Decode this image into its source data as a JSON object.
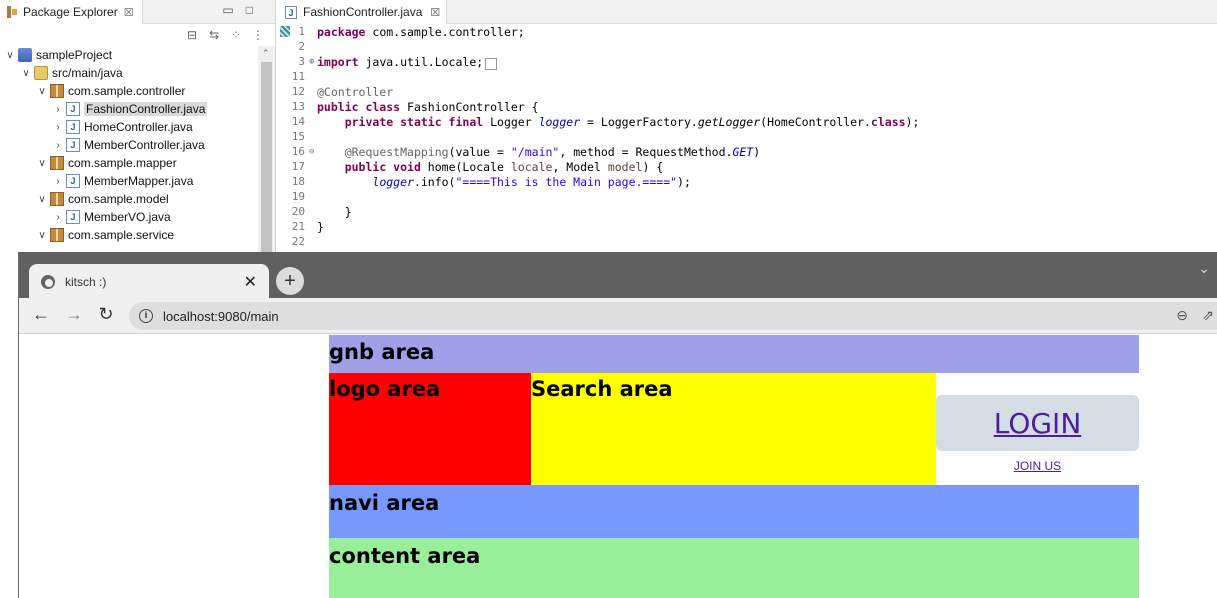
{
  "package_explorer": {
    "tab_label": "Package Explorer",
    "close_glyph": "☒",
    "tree": [
      {
        "indent": 0,
        "arrow": "∨",
        "icon": "project",
        "label": "sampleProject"
      },
      {
        "indent": 1,
        "arrow": "∨",
        "icon": "srcfolder",
        "label": "src/main/java"
      },
      {
        "indent": 2,
        "arrow": "∨",
        "icon": "pkgi",
        "label": "com.sample.controller"
      },
      {
        "indent": 3,
        "arrow": "›",
        "icon": "java",
        "label": "FashionController.java",
        "selected": true
      },
      {
        "indent": 3,
        "arrow": "›",
        "icon": "java",
        "label": "HomeController.java"
      },
      {
        "indent": 3,
        "arrow": "›",
        "icon": "java",
        "label": "MemberController.java"
      },
      {
        "indent": 2,
        "arrow": "∨",
        "icon": "pkgi",
        "label": "com.sample.mapper"
      },
      {
        "indent": 3,
        "arrow": "›",
        "icon": "java",
        "label": "MemberMapper.java"
      },
      {
        "indent": 2,
        "arrow": "∨",
        "icon": "pkgi",
        "label": "com.sample.model"
      },
      {
        "indent": 3,
        "arrow": "›",
        "icon": "java",
        "label": "MemberVO.java"
      },
      {
        "indent": 2,
        "arrow": "∨",
        "icon": "pkgi",
        "label": "com.sample.service"
      }
    ]
  },
  "editor": {
    "tab_label": "FashionController.java",
    "close_glyph": "☒",
    "lines": [
      {
        "num": "1",
        "html": "<span class='kw'>package</span> com.sample.controller;",
        "marker": true
      },
      {
        "num": "2",
        "html": ""
      },
      {
        "num": "3",
        "fold": "⊕",
        "html": "<span class='kw'>import</span> java.util.Locale;<span class='collapsed'>&nbsp;</span>"
      },
      {
        "num": "11",
        "html": ""
      },
      {
        "num": "12",
        "html": "<span class='ann'>@Controller</span>"
      },
      {
        "num": "13",
        "html": "<span class='kw'>public class</span> FashionController {"
      },
      {
        "num": "14",
        "html": "    <span class='kw'>private static final</span> Logger <span class='fld'>logger</span> = LoggerFactory.<span class='ital'>getLogger</span>(HomeController.<span class='kw'>class</span>);"
      },
      {
        "num": "15",
        "html": ""
      },
      {
        "num": "16",
        "fold": "⊖",
        "html": "    <span class='ann'>@RequestMapping</span>(value = <span class='str'>\"/main\"</span>, method = RequestMethod.<span class='fld'>GET</span>)"
      },
      {
        "num": "17",
        "html": "    <span class='kw'>public void</span> home(Locale <span class='loc'>locale</span>, Model <span class='loc'>model</span>) {"
      },
      {
        "num": "18",
        "html": "        <span class='fld'>logger</span>.info(<span class='str'>\"====This is the Main page.====\"</span>);"
      },
      {
        "num": "19",
        "html": ""
      },
      {
        "num": "20",
        "html": "    }"
      },
      {
        "num": "21",
        "html": "}"
      },
      {
        "num": "22",
        "html": ""
      }
    ]
  },
  "browser": {
    "tab_title": "kitsch :)",
    "tab_close": "✕",
    "new_tab": "+",
    "url": "localhost:9080/main",
    "back": "←",
    "forward": "→",
    "reload": "↻",
    "menu_chevron": "⌄"
  },
  "page": {
    "gnb": "gnb area",
    "logo": "logo area",
    "search": "Search area",
    "login_button": "LOGIN",
    "join_link": "JOIN US",
    "navi": "navi area",
    "content": "content area"
  },
  "colors": {
    "gnb": "#a0a0e8",
    "logo": "#ff0000",
    "search": "#ffff00",
    "navi": "#7799ff",
    "content": "#99ee99",
    "login_bg": "#d3dde3",
    "link": "#4b1ea1"
  }
}
